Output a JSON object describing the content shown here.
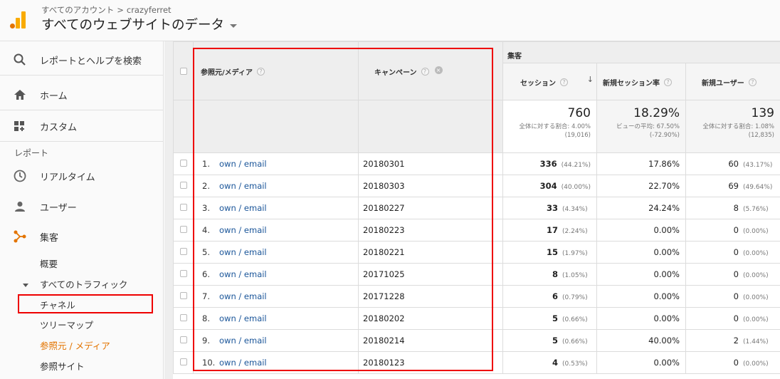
{
  "header": {
    "breadcrumb_root": "すべてのアカウント",
    "breadcrumb_sep": ">",
    "account": "crazyferret",
    "view_title": "すべてのウェブサイトのデータ"
  },
  "sidebar": {
    "search": "レポートとヘルプを検索",
    "home": "ホーム",
    "custom": "カスタム",
    "reports_label": "レポート",
    "realtime": "リアルタイム",
    "users": "ユーザー",
    "acquisition": "集客",
    "overview": "概要",
    "all_traffic": "すべてのトラフィック",
    "channels": "チャネル",
    "treemap": "ツリーマップ",
    "source_medium": "参照元 / メディア",
    "referrals": "参照サイト"
  },
  "table": {
    "group_header": "集客",
    "col_source": "参照元/メディア",
    "col_campaign": "キャンペーン",
    "col_sessions": "セッション",
    "col_new_session_rate": "新規セッション率",
    "col_new_users": "新規ユーザー",
    "help": "?",
    "sort_arrow": "↓",
    "remove": "×",
    "summary": {
      "sessions": "760",
      "sessions_note1": "全体に対する割合: 4.00%",
      "sessions_note2": "(19,016)",
      "rate": "18.29%",
      "rate_note1": "ビューの平均: 67.50%",
      "rate_note2": "(-72.90%)",
      "users": "139",
      "users_note1": "全体に対する割合: 1.08%",
      "users_note2": "(12,835)"
    },
    "rows": [
      {
        "idx": "1.",
        "source": "own / email",
        "campaign": "20180301",
        "sessions": "336",
        "sessions_pct": "(44.21%)",
        "rate": "17.86%",
        "users": "60",
        "users_pct": "(43.17%)"
      },
      {
        "idx": "2.",
        "source": "own / email",
        "campaign": "20180303",
        "sessions": "304",
        "sessions_pct": "(40.00%)",
        "rate": "22.70%",
        "users": "69",
        "users_pct": "(49.64%)"
      },
      {
        "idx": "3.",
        "source": "own / email",
        "campaign": "20180227",
        "sessions": "33",
        "sessions_pct": "(4.34%)",
        "rate": "24.24%",
        "users": "8",
        "users_pct": "(5.76%)"
      },
      {
        "idx": "4.",
        "source": "own / email",
        "campaign": "20180223",
        "sessions": "17",
        "sessions_pct": "(2.24%)",
        "rate": "0.00%",
        "users": "0",
        "users_pct": "(0.00%)"
      },
      {
        "idx": "5.",
        "source": "own / email",
        "campaign": "20180221",
        "sessions": "15",
        "sessions_pct": "(1.97%)",
        "rate": "0.00%",
        "users": "0",
        "users_pct": "(0.00%)"
      },
      {
        "idx": "6.",
        "source": "own / email",
        "campaign": "20171025",
        "sessions": "8",
        "sessions_pct": "(1.05%)",
        "rate": "0.00%",
        "users": "0",
        "users_pct": "(0.00%)"
      },
      {
        "idx": "7.",
        "source": "own / email",
        "campaign": "20171228",
        "sessions": "6",
        "sessions_pct": "(0.79%)",
        "rate": "0.00%",
        "users": "0",
        "users_pct": "(0.00%)"
      },
      {
        "idx": "8.",
        "source": "own / email",
        "campaign": "20180202",
        "sessions": "5",
        "sessions_pct": "(0.66%)",
        "rate": "0.00%",
        "users": "0",
        "users_pct": "(0.00%)"
      },
      {
        "idx": "9.",
        "source": "own / email",
        "campaign": "20180214",
        "sessions": "5",
        "sessions_pct": "(0.66%)",
        "rate": "40.00%",
        "users": "2",
        "users_pct": "(1.44%)"
      },
      {
        "idx": "10.",
        "source": "own / email",
        "campaign": "20180123",
        "sessions": "4",
        "sessions_pct": "(0.53%)",
        "rate": "0.00%",
        "users": "0",
        "users_pct": "(0.00%)"
      }
    ]
  },
  "colors": {
    "accent_orange": "#e37400",
    "highlight_red": "#e00000",
    "link_blue": "#1a5599"
  }
}
